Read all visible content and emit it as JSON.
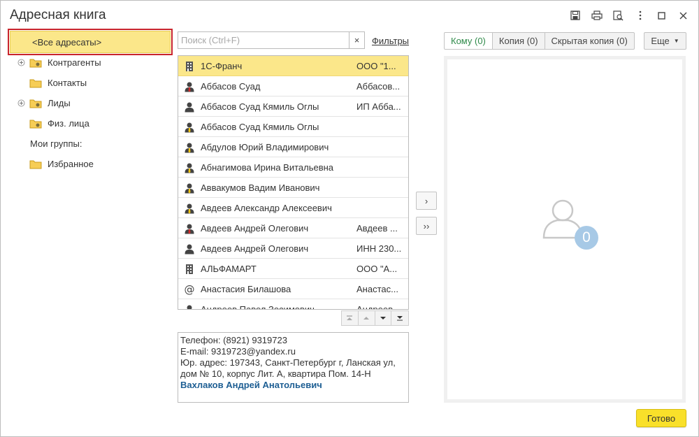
{
  "window": {
    "title": "Адресная книга"
  },
  "tree": {
    "all_label": "<Все адресаты>",
    "items": [
      {
        "label": "Контрагенты",
        "expandable": true
      },
      {
        "label": "Контакты",
        "expandable": false
      },
      {
        "label": "Лиды",
        "expandable": true
      },
      {
        "label": "Физ. лица",
        "expandable": false
      }
    ],
    "my_groups_label": "Мои группы:",
    "favorites_label": "Избранное"
  },
  "search": {
    "placeholder": "Поиск (Ctrl+F)",
    "clear_label": "×",
    "filters_label": "Фильтры"
  },
  "contacts": [
    {
      "icon": "building-icon",
      "name": "1С-Франч",
      "org": "ООО \"1...",
      "selected": true
    },
    {
      "icon": "person-red-tie-icon",
      "name": "Аббасов Суад",
      "org": "Аббасов..."
    },
    {
      "icon": "person-icon",
      "name": "Аббасов Суад Кямиль Оглы",
      "org": "ИП Абба..."
    },
    {
      "icon": "person-yellow-tie-icon",
      "name": "Аббасов Суад Кямиль Оглы",
      "org": ""
    },
    {
      "icon": "person-yellow-tie-icon",
      "name": "Абдулов Юрий Владимирович",
      "org": ""
    },
    {
      "icon": "person-yellow-tie-icon",
      "name": "Абнагимова Ирина Витальевна",
      "org": ""
    },
    {
      "icon": "person-yellow-tie-icon",
      "name": "Аввакумов Вадим Иванович",
      "org": ""
    },
    {
      "icon": "person-yellow-tie-icon",
      "name": "Авдеев Александр Алексеевич",
      "org": ""
    },
    {
      "icon": "person-red-tie-icon",
      "name": "Авдеев Андрей Олегович",
      "org": "Авдеев ..."
    },
    {
      "icon": "person-icon",
      "name": "Авдеев Андрей Олегович",
      "org": "ИНН 230..."
    },
    {
      "icon": "building-icon",
      "name": "АЛЬФАМАРТ",
      "org": "ООО \"А..."
    },
    {
      "icon": "at-icon",
      "name": "Анастасия Билашова",
      "org": "Анастас..."
    },
    {
      "icon": "person-red-tie-icon",
      "name": "Андреев Павел Зосимович",
      "org": "Андреев..."
    }
  ],
  "details": {
    "line1": "Телефон: (8921) 9319723",
    "line2": "E-mail: 9319723@yandex.ru",
    "line3": "Юр. адрес: 197343, Санкт-Петербург г, Ланская ул,",
    "line4": "дом № 10, корпус Лит. А, квартира Пом. 14-Н",
    "contact_link": "Вахлаков Андрей Анатольевич"
  },
  "transfer": {
    "add_one": "›",
    "add_all": "››"
  },
  "recipient_tabs": [
    {
      "label": "Кому (0)",
      "active": true
    },
    {
      "label": "Копия (0)",
      "active": false
    },
    {
      "label": "Скрытая копия (0)",
      "active": false
    }
  ],
  "more_label": "Еще",
  "recipients_count": "0",
  "done_label": "Готово",
  "colors": {
    "selected_bg": "#fbe78a",
    "highlight_border": "#c9252c",
    "link": "#1d5e93",
    "active_tab_text": "#2f8a4a",
    "done_button": "#f9e02a",
    "badge": "#a7c9e6"
  }
}
